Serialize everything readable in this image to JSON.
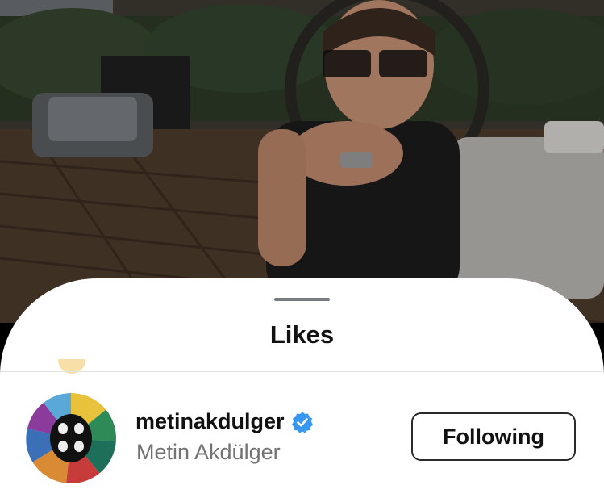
{
  "sheet": {
    "title": "Likes"
  },
  "likes": [
    {
      "username": "metinakdulger",
      "full_name": "Metin Akdülger",
      "verified": true,
      "follow_label": "Following"
    }
  ],
  "colors": {
    "verified_badge": "#3897f0",
    "muted_text": "#737373",
    "button_border": "#2a2a2a"
  },
  "icons": {
    "verified": "verified-badge-icon",
    "grabber": "drag-handle"
  }
}
